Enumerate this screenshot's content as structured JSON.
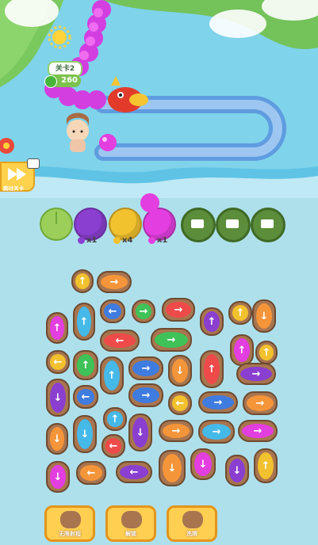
{
  "hud": {
    "level": "关卡2",
    "coins": "260"
  },
  "skip_level": {
    "label": "跳过关卡"
  },
  "slots": [
    {
      "kind": "lily-pad",
      "color": "#9ccf5a"
    },
    {
      "kind": "jar",
      "color": "#8a3fd0"
    },
    {
      "kind": "jar",
      "color": "#f2c12e"
    },
    {
      "kind": "jar",
      "color": "#e33ee0"
    },
    {
      "kind": "video-slot",
      "icon": "video-icon"
    },
    {
      "kind": "video-slot",
      "icon": "video-icon"
    },
    {
      "kind": "video-slot",
      "icon": "video-icon"
    }
  ],
  "slot_counts": [
    {
      "color": "#8a3fd0",
      "text": "x1"
    },
    {
      "color": "#f2c12e",
      "text": "x4"
    },
    {
      "color": "#e33ee0",
      "text": "x1"
    }
  ],
  "tools": [
    {
      "label": "无限射程"
    },
    {
      "label": "解锁"
    },
    {
      "label": "洗牌"
    }
  ],
  "palette": {
    "orange": "#f5953a",
    "blue": "#3f7ce0",
    "cyan": "#45b9e8",
    "red": "#ef4a4a",
    "green": "#3fc257",
    "purple": "#8a3fd0",
    "pink": "#e33ee0",
    "yellow": "#f2c12e"
  }
}
